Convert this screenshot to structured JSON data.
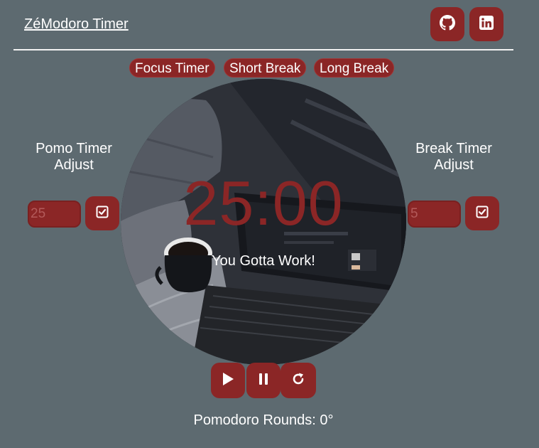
{
  "header": {
    "title": "ZéModoro Timer",
    "github_icon": "github-icon",
    "linkedin_icon": "linkedin-icon"
  },
  "tabs": [
    {
      "label": "Focus Timer"
    },
    {
      "label": "Short Break"
    },
    {
      "label": "Long Break"
    }
  ],
  "timer": {
    "display": "25:00",
    "message": "You Gotta Work!"
  },
  "pomo_adjust": {
    "label_line1": "Pomo Timer",
    "label_line2": "Adjust",
    "value": "25",
    "confirm_icon": "checkbox-icon"
  },
  "break_adjust": {
    "label_line1": "Break Timer",
    "label_line2": "Adjust",
    "value": "5",
    "confirm_icon": "checkbox-icon"
  },
  "controls": {
    "play_icon": "play-icon",
    "pause_icon": "pause-icon",
    "reset_icon": "reset-icon"
  },
  "rounds": {
    "text": "Pomodoro Rounds: 0°"
  },
  "colors": {
    "background": "#5d6a70",
    "accent": "#8b2626",
    "text": "#ffffff"
  }
}
